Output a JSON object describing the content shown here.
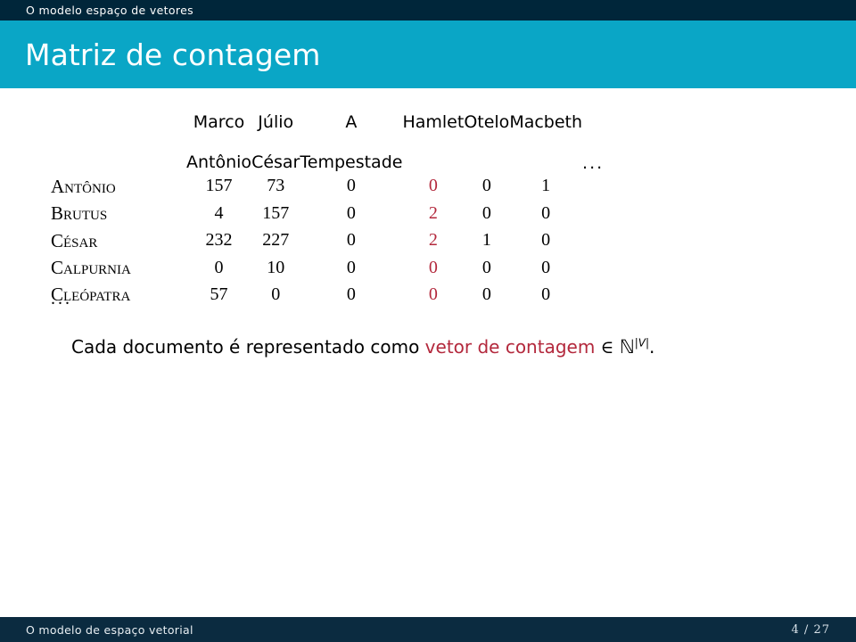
{
  "nav": {
    "section_title": "O modelo espaço de vetores"
  },
  "title_band": {
    "frame_title": "Matriz de contagem"
  },
  "colors": {
    "nav_bar": "#00263a",
    "title_band": "#0aa6c6",
    "footer_bar": "#0b2b40",
    "accent_highlight": "#b3283c",
    "text": "#000000",
    "background": "#ffffff"
  },
  "table": {
    "corner_label": "",
    "column_headers": [
      {
        "line1": "Marco",
        "line2": "Antônio"
      },
      {
        "line1": "Júlio",
        "line2": "César"
      },
      {
        "line1": "A",
        "line2": "Tempestade"
      },
      {
        "line1": "Hamlet",
        "line2": ""
      },
      {
        "line1": "Otelo",
        "line2": ""
      },
      {
        "line1": "Macbeth",
        "line2": ""
      }
    ],
    "trailing_header": "...",
    "highlight_column_index": 3,
    "rows": [
      {
        "label": "Antônio",
        "values": [
          "157",
          "73",
          "0",
          "0",
          "0",
          "1"
        ]
      },
      {
        "label": "Brutus",
        "values": [
          "4",
          "157",
          "0",
          "2",
          "0",
          "0"
        ]
      },
      {
        "label": "César",
        "values": [
          "232",
          "227",
          "0",
          "2",
          "1",
          "0"
        ]
      },
      {
        "label": "Calpurnia",
        "values": [
          "0",
          "10",
          "0",
          "0",
          "0",
          "0"
        ]
      },
      {
        "label": "Cleópatra",
        "values": [
          "57",
          "0",
          "0",
          "0",
          "0",
          "0"
        ]
      }
    ],
    "trailing_row": "..."
  },
  "caption": {
    "lead": "Cada documento é representado como ",
    "accent": "vetor de contagem",
    "membership": " ∈ ",
    "set_symbol": "ℕ",
    "exponent": "|V|",
    "period": "."
  },
  "footer": {
    "left_text": "O modelo de espaço vetorial",
    "page": "4 / 27"
  }
}
